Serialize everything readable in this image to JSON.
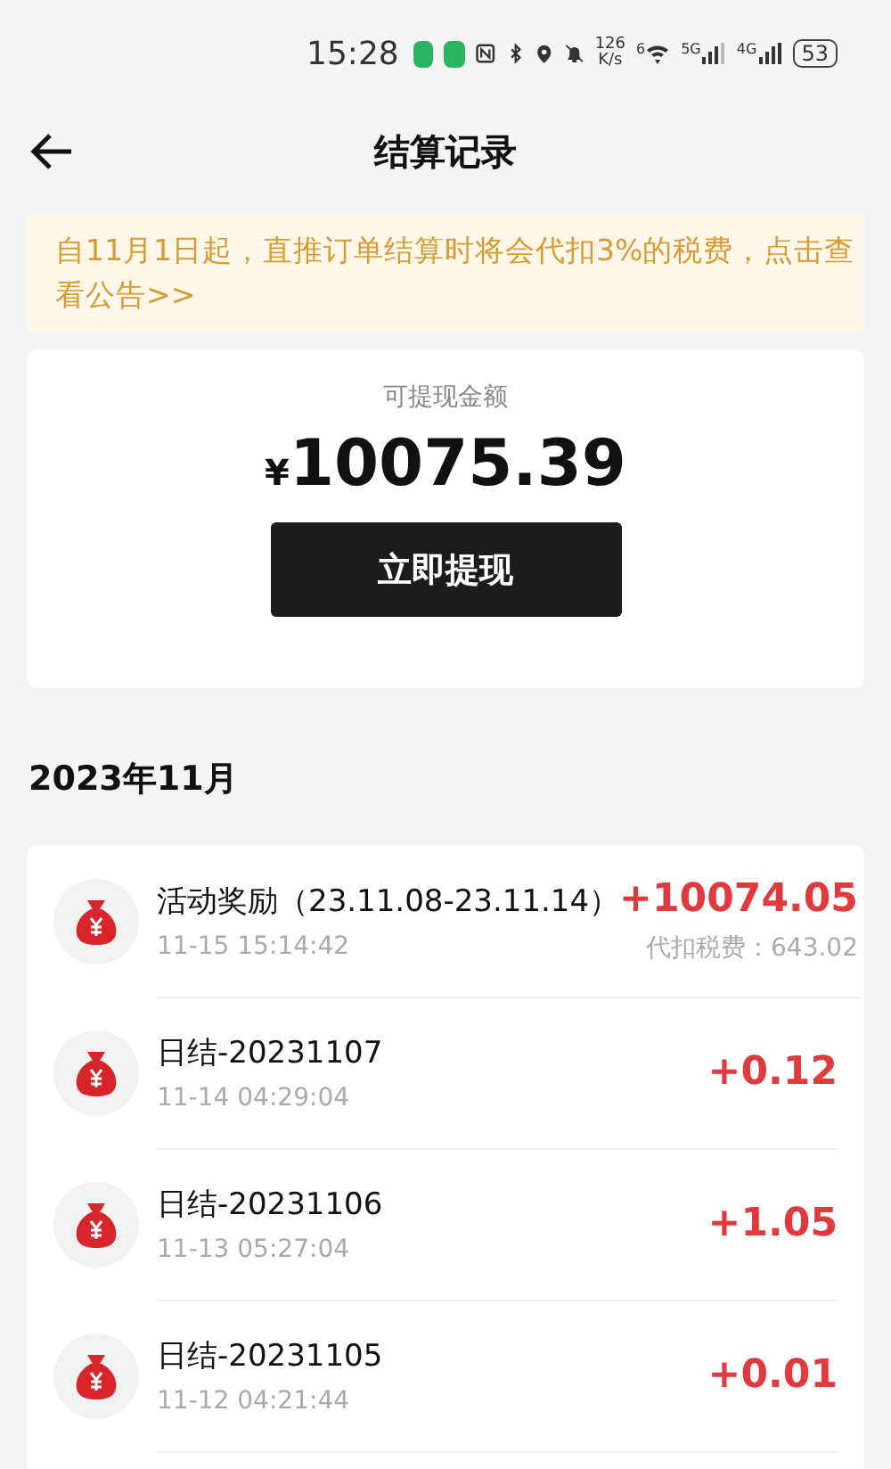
{
  "status_bar": {
    "time": "15:28",
    "speed_value": "126",
    "speed_unit": "K/s",
    "wifi_label": "6",
    "network_1": "5G",
    "network_2": "4G",
    "battery": "53"
  },
  "header": {
    "title": "结算记录"
  },
  "notice": {
    "text": "自11月1日起，直推订单结算时将会代扣3%的税费，点击查看公告>>"
  },
  "balance": {
    "label": "可提现金额",
    "currency": "¥",
    "amount": "10075.39",
    "button": "立即提现"
  },
  "month": "2023年11月",
  "records": [
    {
      "title": "活动奖励（23.11.08-23.11.14）",
      "time": "11-15 15:14:42",
      "amount": "+10074.05",
      "tax": "代扣税费：643.02"
    },
    {
      "title": "日结-20231107",
      "time": "11-14 04:29:04",
      "amount": "+0.12"
    },
    {
      "title": "日结-20231106",
      "time": "11-13 05:27:04",
      "amount": "+1.05"
    },
    {
      "title": "日结-20231105",
      "time": "11-12 04:21:44",
      "amount": "+0.01"
    }
  ]
}
